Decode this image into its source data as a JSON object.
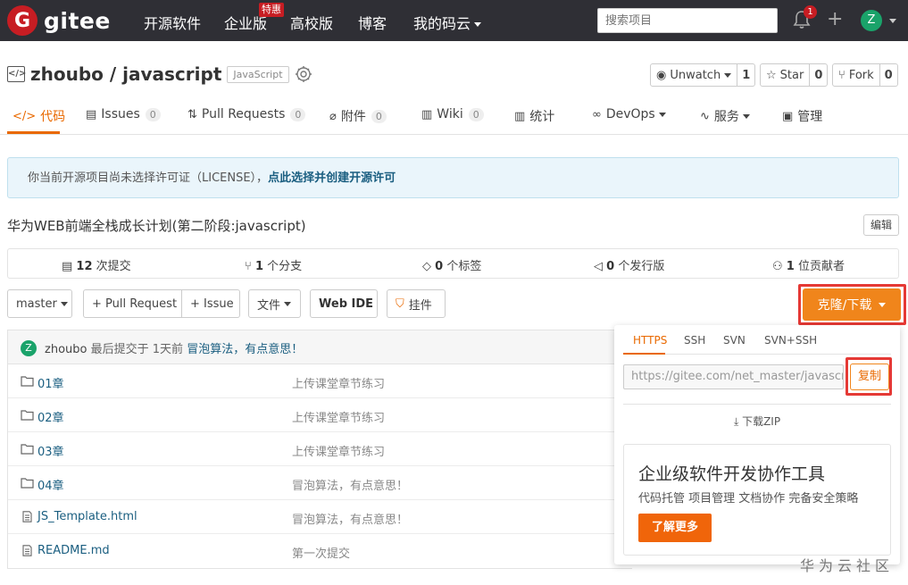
{
  "nav": {
    "logo_letter": "G",
    "logo_text": "gitee",
    "links": [
      "开源软件",
      "企业版",
      "高校版",
      "博客",
      "我的码云"
    ],
    "sale_badge": "特惠",
    "search_placeholder": "搜索项目",
    "notification_count": "1",
    "plus": "+",
    "avatar_letter": "Z"
  },
  "repo": {
    "icon": "</>",
    "owner_repo": "zhoubo / javascript",
    "language": "JavaScript",
    "buttons": [
      {
        "label": "Unwatch",
        "count": "1"
      },
      {
        "label": "Star",
        "count": "0"
      },
      {
        "label": "Fork",
        "count": "0"
      }
    ]
  },
  "tabs": [
    {
      "label": "代码",
      "count": ""
    },
    {
      "label": "Issues",
      "count": "0"
    },
    {
      "label": "Pull Requests",
      "count": "0"
    },
    {
      "label": "附件",
      "count": "0"
    },
    {
      "label": "Wiki",
      "count": "0"
    },
    {
      "label": "统计",
      "count": ""
    },
    {
      "label": "DevOps",
      "count": ""
    },
    {
      "label": "服务",
      "count": ""
    },
    {
      "label": "管理",
      "count": ""
    }
  ],
  "notice": {
    "text": "你当前开源项目尚未选择许可证（LICENSE），",
    "link": "点此选择并创建开源许可"
  },
  "description": "华为WEB前端全栈成长计划(第二阶段:javascript)",
  "edit_label": "编辑",
  "stats": [
    {
      "num": "12",
      "label": "次提交"
    },
    {
      "num": "1",
      "label": "个分支"
    },
    {
      "num": "0",
      "label": "个标签"
    },
    {
      "num": "0",
      "label": "个发行版"
    },
    {
      "num": "1",
      "label": "位贡献者"
    }
  ],
  "toolbar": {
    "branch": "master",
    "pull_request": "+ Pull Request",
    "issue": "+ Issue",
    "files": "文件",
    "web_ide": "Web IDE",
    "widget": "挂件",
    "clone": "克隆/下载"
  },
  "commit": {
    "avatar_letter": "Z",
    "author": "zhoubo",
    "prefix": "最后提交于",
    "time": "1天前",
    "message": "冒泡算法，有点意思！"
  },
  "files": [
    {
      "type": "folder",
      "name": "01章",
      "message": "上传课堂章节练习"
    },
    {
      "type": "folder",
      "name": "02章",
      "message": "上传课堂章节练习"
    },
    {
      "type": "folder",
      "name": "03章",
      "message": "上传课堂章节练习"
    },
    {
      "type": "folder",
      "name": "04章",
      "message": "冒泡算法，有点意思！"
    },
    {
      "type": "file",
      "name": "JS_Template.html",
      "message": "冒泡算法，有点意思！"
    },
    {
      "type": "file",
      "name": "README.md",
      "message": "第一次提交"
    }
  ],
  "clone_panel": {
    "protocols": [
      "HTTPS",
      "SSH",
      "SVN",
      "SVN+SSH"
    ],
    "url": "https://gitee.com/net_master/javascript",
    "copy": "复制",
    "download_zip": "下载ZIP",
    "promo_title": "企业级软件开发协作工具",
    "promo_sub": "代码托管 项目管理 文档协作 完备安全策略",
    "promo_btn": "了解更多"
  },
  "watermark": "华为云社区",
  "colors": {
    "accent": "#e96900",
    "brand_red": "#c71d23",
    "nav_bg": "#2f2f35",
    "highlight": "#e53935"
  }
}
